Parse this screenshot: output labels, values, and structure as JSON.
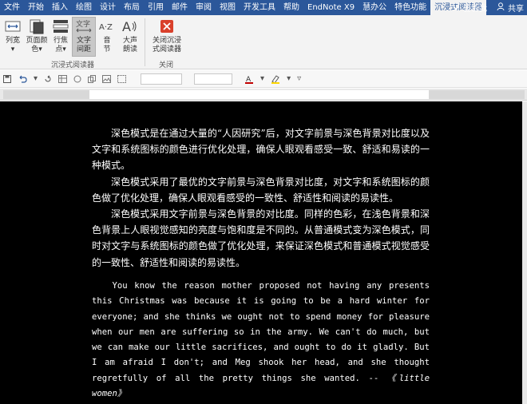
{
  "menubar": {
    "items": [
      "文件",
      "开始",
      "插入",
      "绘图",
      "设计",
      "布局",
      "引用",
      "邮件",
      "审阅",
      "视图",
      "开发工具",
      "帮助",
      "EndNote X9",
      "慧办公",
      "特色功能",
      "沉浸式阅读器"
    ],
    "tell_me": "告诉我",
    "share": "共享"
  },
  "ribbon": {
    "column_width": [
      "列宽",
      "▾"
    ],
    "page_color": [
      "页面颜",
      "色▾"
    ],
    "line_focus": [
      "行焦",
      "点▾"
    ],
    "text_spacing": [
      "文字",
      "间距"
    ],
    "syllables": [
      "音",
      "节"
    ],
    "read_aloud": [
      "大声",
      "朗读"
    ],
    "close_reader": [
      "关闭沉浸",
      "式阅读器"
    ],
    "group_reader": "沉浸式阅读器",
    "group_close": "关闭"
  },
  "document": {
    "chinese_paragraphs": [
      "深色模式是在通过大量的“人因研究”后，对文字前景与深色背景对比度以及文字和系统图标的颜色进行优化处理，确保人眼观看感受一致、舒适和易读的一种模式。",
      "深色模式采用了最优的文字前景与深色背景对比度，对文字和系统图标的颜色做了优化处理，确保人眼观看感受的一致性、舒适性和阅读的易读性。",
      "深色模式采用文字前景与深色背景的对比度。同样的色彩，在浅色背景和深色背景上人眼视觉感知的亮度与饱和度是不同的。从普通模式变为深色模式，同时对文字与系统图标的颜色做了优化处理，来保证深色模式和普通模式视觉感受的一致性、舒适性和阅读的易读性。"
    ],
    "english_paragraph": "You know the reason mother proposed not having any presents this Christmas was because it is going to be a hard winter for everyone; and she thinks we ought not to spend money for pleasure when our men are suffering so in the army. We can't do much, but we can make our little sacrifices, and ought to do it gladly. But I am afraid I don't; and Meg shook her head, and she thought regretfully of all the pretty things she wanted. -- ",
    "english_source": "《little women》"
  }
}
